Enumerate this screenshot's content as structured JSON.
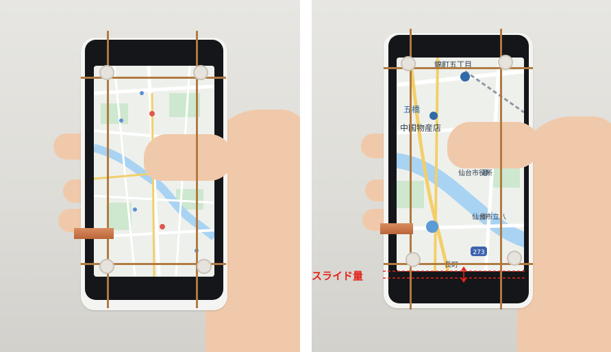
{
  "annotation": {
    "slide_label": "スライド量",
    "color": "#e3241b"
  },
  "right_map": {
    "labels": {
      "top": "錦町五丁目",
      "station": "五橋",
      "hospital": "中国物産店",
      "cemetery": "仙台市役所",
      "elementary": "仙台市立八",
      "route_badge": "273",
      "bottom": "長町"
    }
  },
  "colors": {
    "background": "#e2e1dc",
    "skin": "#f0c9aa",
    "phone": "#15161a",
    "rubber_band": "#b07a40",
    "map_water": "#a9d3f3",
    "map_park": "#cde8cf",
    "map_road_major": "#f2cf6a"
  }
}
